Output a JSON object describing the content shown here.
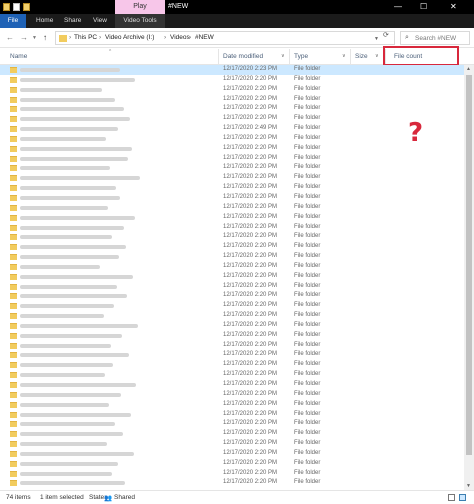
{
  "window": {
    "title": "#NEW",
    "contextual_tab": "Play",
    "controls": {
      "minimize": "—",
      "maximize": "☐",
      "close": "✕"
    }
  },
  "ribbon": {
    "tabs": [
      "File",
      "Home",
      "Share",
      "View",
      "Video Tools"
    ]
  },
  "address": {
    "crumbs": [
      "This PC",
      "Video Archive (I:)",
      "Videos",
      "#NEW"
    ],
    "search_placeholder": "Search #NEW"
  },
  "columns": {
    "name": "Name",
    "date": "Date modified",
    "type": "Type",
    "size": "Size",
    "file_count": "File count"
  },
  "annotation": {
    "mark": "?"
  },
  "rows": [
    {
      "date": "12/17/2020 2:23 PM",
      "type": "File folder",
      "selected": true
    },
    {
      "date": "12/17/2020 2:20 PM",
      "type": "File folder"
    },
    {
      "date": "12/17/2020 2:20 PM",
      "type": "File folder"
    },
    {
      "date": "12/17/2020 2:20 PM",
      "type": "File folder"
    },
    {
      "date": "12/17/2020 2:20 PM",
      "type": "File folder"
    },
    {
      "date": "12/17/2020 2:20 PM",
      "type": "File folder"
    },
    {
      "date": "12/17/2020 2:49 PM",
      "type": "File folder"
    },
    {
      "date": "12/17/2020 2:20 PM",
      "type": "File folder"
    },
    {
      "date": "12/17/2020 2:20 PM",
      "type": "File folder"
    },
    {
      "date": "12/17/2020 2:20 PM",
      "type": "File folder"
    },
    {
      "date": "12/17/2020 2:20 PM",
      "type": "File folder"
    },
    {
      "date": "12/17/2020 2:20 PM",
      "type": "File folder"
    },
    {
      "date": "12/17/2020 2:20 PM",
      "type": "File folder"
    },
    {
      "date": "12/17/2020 2:20 PM",
      "type": "File folder"
    },
    {
      "date": "12/17/2020 2:20 PM",
      "type": "File folder"
    },
    {
      "date": "12/17/2020 2:20 PM",
      "type": "File folder"
    },
    {
      "date": "12/17/2020 2:20 PM",
      "type": "File folder"
    },
    {
      "date": "12/17/2020 2:20 PM",
      "type": "File folder"
    },
    {
      "date": "12/17/2020 2:20 PM",
      "type": "File folder"
    },
    {
      "date": "12/17/2020 2:20 PM",
      "type": "File folder"
    },
    {
      "date": "12/17/2020 2:20 PM",
      "type": "File folder"
    },
    {
      "date": "12/17/2020 2:20 PM",
      "type": "File folder"
    },
    {
      "date": "12/17/2020 2:20 PM",
      "type": "File folder"
    },
    {
      "date": "12/17/2020 2:20 PM",
      "type": "File folder"
    },
    {
      "date": "12/17/2020 2:20 PM",
      "type": "File folder"
    },
    {
      "date": "12/17/2020 2:20 PM",
      "type": "File folder"
    },
    {
      "date": "12/17/2020 2:20 PM",
      "type": "File folder"
    },
    {
      "date": "12/17/2020 2:20 PM",
      "type": "File folder"
    },
    {
      "date": "12/17/2020 2:20 PM",
      "type": "File folder"
    },
    {
      "date": "12/17/2020 2:20 PM",
      "type": "File folder"
    },
    {
      "date": "12/17/2020 2:20 PM",
      "type": "File folder"
    },
    {
      "date": "12/17/2020 2:20 PM",
      "type": "File folder"
    },
    {
      "date": "12/17/2020 2:20 PM",
      "type": "File folder"
    },
    {
      "date": "12/17/2020 2:20 PM",
      "type": "File folder"
    },
    {
      "date": "12/17/2020 2:20 PM",
      "type": "File folder"
    },
    {
      "date": "12/17/2020 2:20 PM",
      "type": "File folder"
    },
    {
      "date": "12/17/2020 2:20 PM",
      "type": "File folder"
    },
    {
      "date": "12/17/2020 2:20 PM",
      "type": "File folder"
    },
    {
      "date": "12/17/2020 2:20 PM",
      "type": "File folder"
    },
    {
      "date": "12/17/2020 2:20 PM",
      "type": "File folder"
    },
    {
      "date": "12/17/2020 2:20 PM",
      "type": "File folder"
    },
    {
      "date": "12/17/2020 2:20 PM",
      "type": "File folder"
    },
    {
      "date": "12/17/2020 2:20 PM",
      "type": "File folder"
    }
  ],
  "status": {
    "items": "74 items",
    "selected": "1 item selected",
    "state_label": "State:",
    "state_value": "Shared"
  }
}
